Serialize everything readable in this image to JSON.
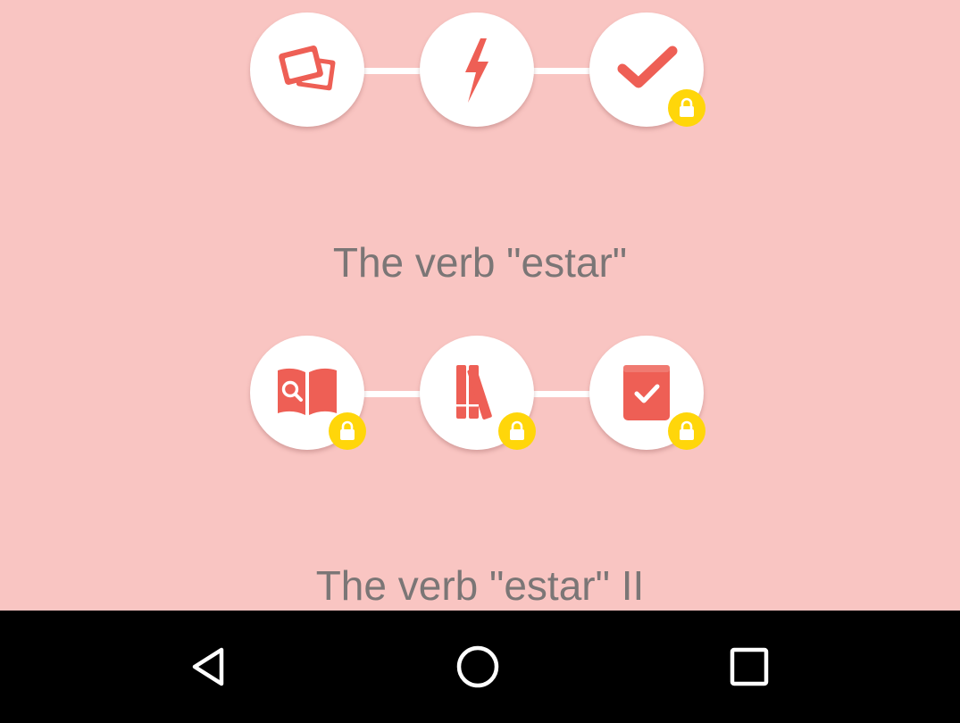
{
  "colors": {
    "background": "#f9c5c2",
    "accent": "#ee5f55",
    "node_fill": "#ffffff",
    "lock_badge": "#ffd60a",
    "title_text": "#7b7676",
    "nav_bar": "#000000"
  },
  "lessons": [
    {
      "title": "",
      "steps": [
        {
          "icon": "flashcards-icon",
          "locked": false
        },
        {
          "icon": "lightning-icon",
          "locked": false
        },
        {
          "icon": "checkmark-icon",
          "locked": true
        }
      ]
    },
    {
      "title": "The verb \"estar\"",
      "steps": [
        {
          "icon": "book-search-icon",
          "locked": true
        },
        {
          "icon": "bookshelf-icon",
          "locked": true
        },
        {
          "icon": "book-check-icon",
          "locked": true
        }
      ]
    },
    {
      "title": "The verb \"estar\" II",
      "steps": []
    }
  ],
  "nav_bar": {
    "buttons": [
      "back-icon",
      "home-icon",
      "recent-apps-icon"
    ]
  }
}
